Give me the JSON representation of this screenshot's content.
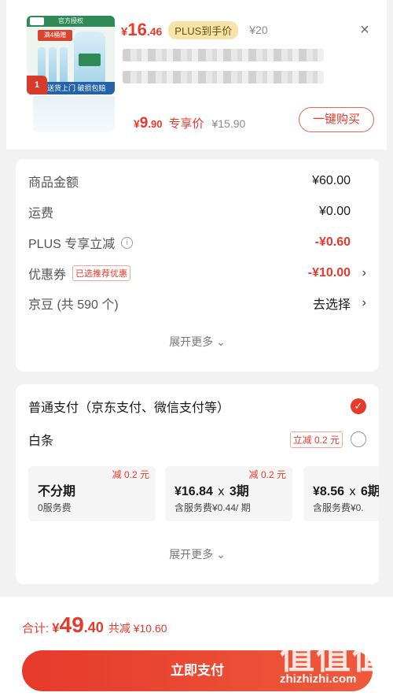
{
  "product": {
    "image_top_tag": "官方授权",
    "image_strip": "满4桶赠",
    "image_bottom": "送货上门 破损包赔",
    "image_corner": "1",
    "price_yen": "¥",
    "price_int": "16",
    "price_dec": ".46",
    "plus_tag": "PLUS到手价",
    "orig_price": "¥20",
    "close_icon": "×"
  },
  "sku": {
    "price_yen": "¥",
    "price_int": "9",
    "price_dec": ".90",
    "tag": "专享价",
    "orig_price": "¥15.90",
    "buy_label": "一键购买"
  },
  "summary": {
    "rows": [
      {
        "label": "商品金额",
        "value": "¥60.00"
      },
      {
        "label": "运费",
        "value": "¥0.00"
      },
      {
        "label": "PLUS 专享立减",
        "value": "-¥0.60"
      },
      {
        "label": "优惠券",
        "tag": "已选推荐优惠",
        "value": "-¥10.00"
      },
      {
        "label": "京豆 (共 590 个)",
        "value": "去选择"
      }
    ],
    "expand_label": "展开更多 ⌄"
  },
  "payment": {
    "normal": "普通支付（京东支付、微信支付等）",
    "baitiao": "白条",
    "baitiao_tag": "立减 0.2 元",
    "plans": [
      {
        "main": "不分期",
        "sub": "0服务费",
        "badge": "减 0.2 元"
      },
      {
        "main": "¥16.84",
        "x": "x",
        "period": "3期",
        "sub": "含服务费¥0.44/ 期",
        "badge": "减 0.2 元"
      },
      {
        "main": "¥8.56",
        "x": "x",
        "period": "6期",
        "sub": "含服务费¥0.",
        "badge": ""
      }
    ],
    "expand_label": "展开更多 ⌄"
  },
  "footer": {
    "total_label": "合计:",
    "total_yen": "¥",
    "total_int": "49",
    "total_dec": ".40",
    "total_save": "共减 ¥10.60",
    "pay_label": "立即支付",
    "watermark_glyphs": "值值值",
    "watermark_text": "zhizhizhi.com"
  },
  "colors": {
    "accent": "#e63a2a",
    "plus_bg": "#f7e4a8"
  }
}
